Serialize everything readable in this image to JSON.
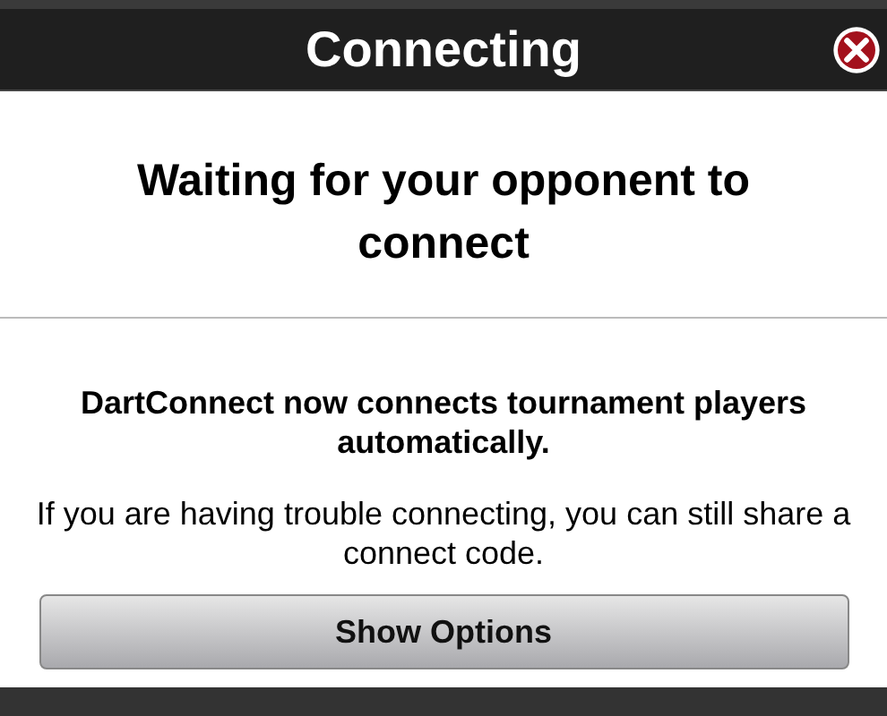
{
  "dialog": {
    "title": "Connecting",
    "heading": "Waiting for your opponent to connect",
    "notice": "DartConnect now connects tournament players automatically.",
    "hint": "If you are having trouble connecting, you can still share a connect code.",
    "button": "Show Options"
  }
}
